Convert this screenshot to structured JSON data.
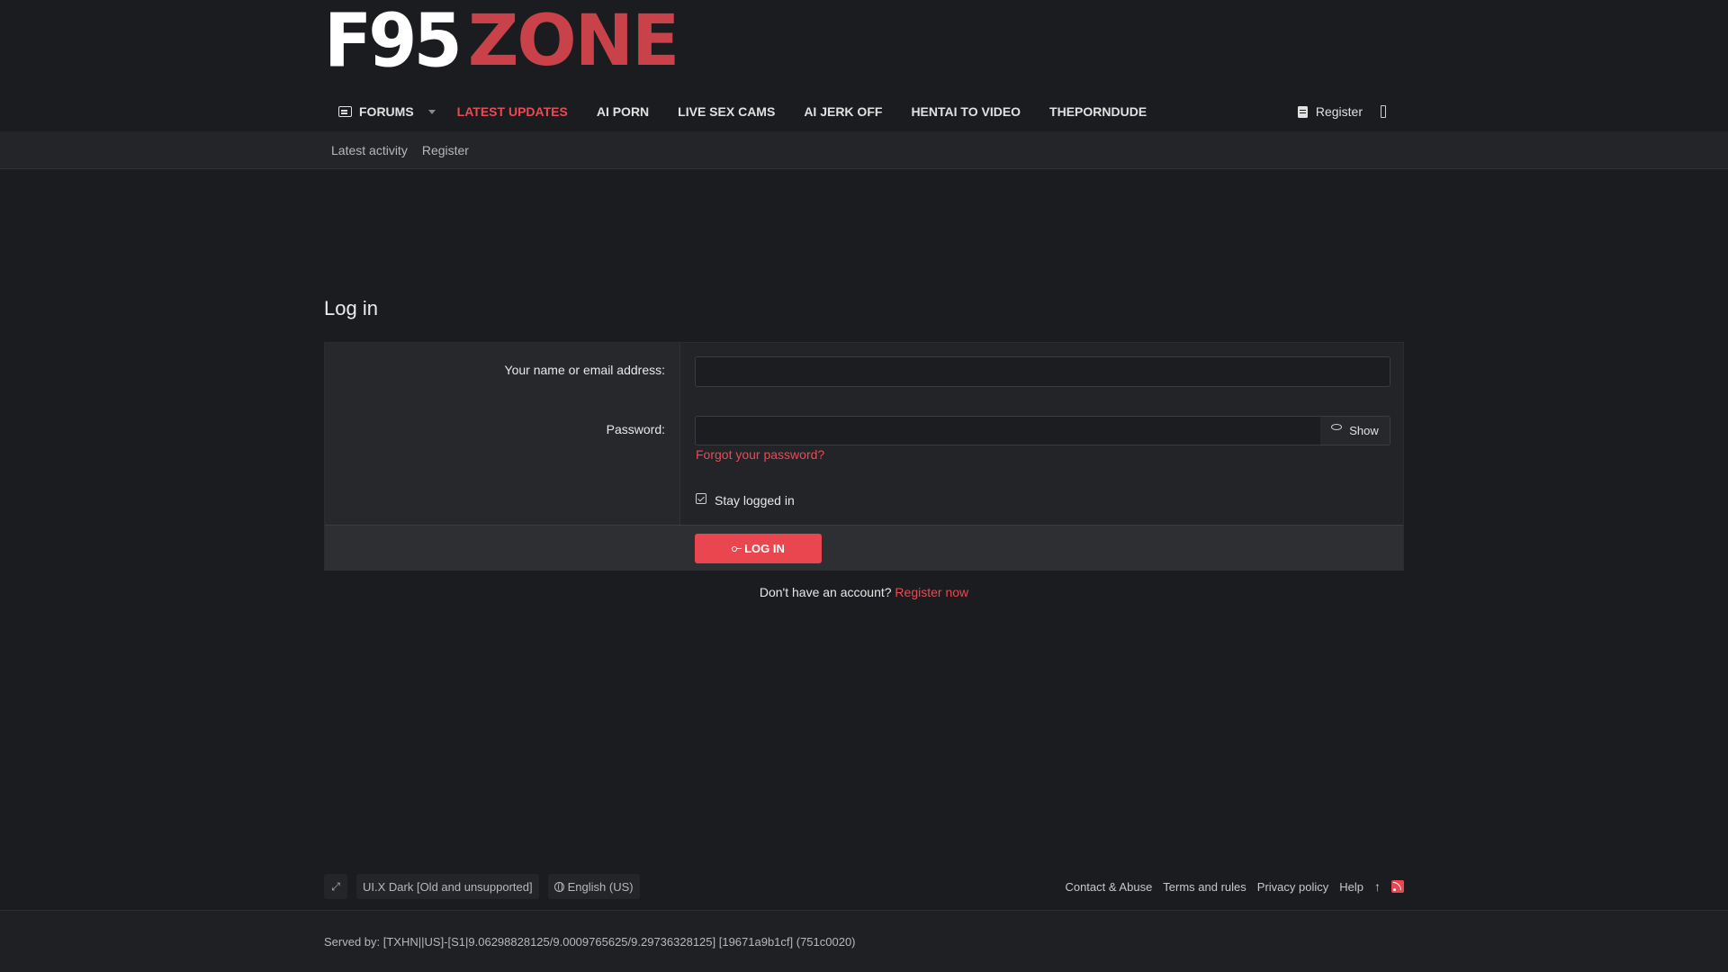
{
  "logo": {
    "part1": "F95",
    "part2": "ZONE",
    "brand_color": "#e9464f"
  },
  "nav": {
    "items": [
      {
        "label": "Forums",
        "icon": "forums-icon"
      },
      {
        "label": "Latest Updates"
      },
      {
        "label": "AI Porn"
      },
      {
        "label": "Live Sex Cams"
      },
      {
        "label": "AI Jerk Off"
      },
      {
        "label": "Hentai to Video"
      },
      {
        "label": "ThePornDude"
      }
    ],
    "register_label": "Register"
  },
  "subnav": {
    "items": [
      "Latest activity",
      "Register"
    ]
  },
  "page": {
    "title": "Log in"
  },
  "form": {
    "name_label": "Your name or email address:",
    "name_value": "",
    "password_label": "Password:",
    "password_value": "",
    "show_label": "Show",
    "forgot_label": "Forgot your password?",
    "stay_label": "Stay logged in",
    "stay_checked": true,
    "submit_label": "Log in"
  },
  "register_prompt": {
    "text": "Don't have an account?",
    "link": "Register now"
  },
  "footer": {
    "style_label": "UI.X Dark [Old and unsupported]",
    "language_label": "English (US)",
    "links": [
      "Contact & Abuse",
      "Terms and rules",
      "Privacy policy",
      "Help"
    ],
    "served_by": "Served by: [TXHN||US]-[S1|9.06298828125/9.0009765625/9.29736328125] [19671a9b1cf] (751c0020)"
  }
}
